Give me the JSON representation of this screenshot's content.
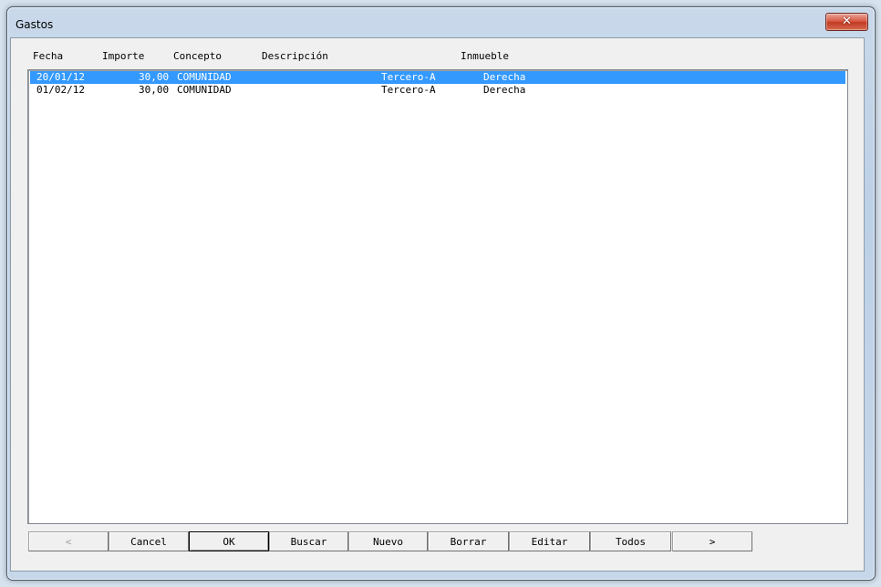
{
  "window": {
    "title": "Gastos",
    "close_label": "✕"
  },
  "columns": [
    "Fecha",
    "Importe",
    "Concepto",
    "Descripción",
    "Inmueble"
  ],
  "rows": [
    {
      "fecha": "20/01/12",
      "importe": "30,00",
      "concepto": "COMUNIDAD",
      "descripcion": "",
      "inmueble": "Tercero-A",
      "extra": "Derecha",
      "selected": true
    },
    {
      "fecha": "01/02/12",
      "importe": "30,00",
      "concepto": "COMUNIDAD",
      "descripcion": "",
      "inmueble": "Tercero-A",
      "extra": "Derecha",
      "selected": false
    }
  ],
  "buttons": {
    "prev": "<",
    "cancel": "Cancel",
    "ok": "OK",
    "buscar": "Buscar",
    "nuevo": "Nuevo",
    "borrar": "Borrar",
    "editar": "Editar",
    "todos": "Todos",
    "next": ">"
  },
  "colors": {
    "selection": "#3399ff",
    "close_button": "#c13a24"
  }
}
